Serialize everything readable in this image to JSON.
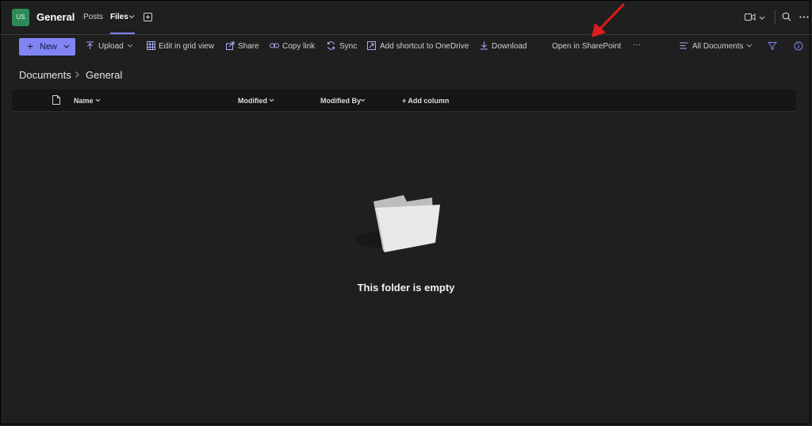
{
  "header": {
    "team_avatar": "US",
    "channel_name": "General",
    "tabs": [
      {
        "label": "Posts",
        "active": false
      },
      {
        "label": "Files",
        "active": true
      }
    ]
  },
  "toolbar": {
    "new_label": "New",
    "upload_label": "Upload",
    "grid_view_label": "Edit in grid view",
    "share_label": "Share",
    "copy_link_label": "Copy link",
    "sync_label": "Sync",
    "shortcut_label": "Add shortcut to OneDrive",
    "download_label": "Download",
    "open_sharepoint_label": "Open in SharePoint",
    "more_label": "···",
    "view_label": "All Documents"
  },
  "breadcrumb": {
    "root": "Documents",
    "current": "General"
  },
  "table": {
    "columns": [
      "Name",
      "Modified",
      "Modified By",
      "+ Add column"
    ]
  },
  "empty_state": {
    "message": "This folder is empty"
  },
  "colors": {
    "accent": "#7f85f5",
    "avatar": "#2e8b57",
    "background": "#1f1f1f",
    "annotation": "#e21b1b"
  }
}
